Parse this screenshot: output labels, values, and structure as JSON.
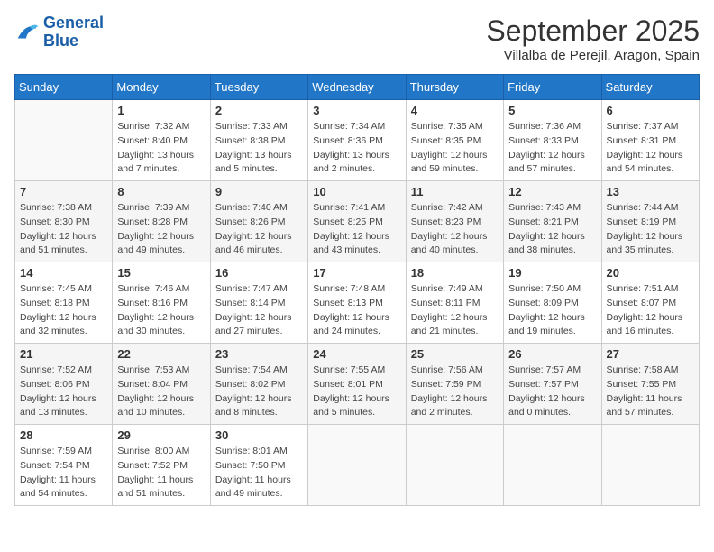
{
  "header": {
    "logo_line1": "General",
    "logo_line2": "Blue",
    "title": "September 2025",
    "subtitle": "Villalba de Perejil, Aragon, Spain"
  },
  "weekdays": [
    "Sunday",
    "Monday",
    "Tuesday",
    "Wednesday",
    "Thursday",
    "Friday",
    "Saturday"
  ],
  "weeks": [
    [
      {
        "day": "",
        "sunrise": "",
        "sunset": "",
        "daylight": ""
      },
      {
        "day": "1",
        "sunrise": "Sunrise: 7:32 AM",
        "sunset": "Sunset: 8:40 PM",
        "daylight": "Daylight: 13 hours and 7 minutes."
      },
      {
        "day": "2",
        "sunrise": "Sunrise: 7:33 AM",
        "sunset": "Sunset: 8:38 PM",
        "daylight": "Daylight: 13 hours and 5 minutes."
      },
      {
        "day": "3",
        "sunrise": "Sunrise: 7:34 AM",
        "sunset": "Sunset: 8:36 PM",
        "daylight": "Daylight: 13 hours and 2 minutes."
      },
      {
        "day": "4",
        "sunrise": "Sunrise: 7:35 AM",
        "sunset": "Sunset: 8:35 PM",
        "daylight": "Daylight: 12 hours and 59 minutes."
      },
      {
        "day": "5",
        "sunrise": "Sunrise: 7:36 AM",
        "sunset": "Sunset: 8:33 PM",
        "daylight": "Daylight: 12 hours and 57 minutes."
      },
      {
        "day": "6",
        "sunrise": "Sunrise: 7:37 AM",
        "sunset": "Sunset: 8:31 PM",
        "daylight": "Daylight: 12 hours and 54 minutes."
      }
    ],
    [
      {
        "day": "7",
        "sunrise": "Sunrise: 7:38 AM",
        "sunset": "Sunset: 8:30 PM",
        "daylight": "Daylight: 12 hours and 51 minutes."
      },
      {
        "day": "8",
        "sunrise": "Sunrise: 7:39 AM",
        "sunset": "Sunset: 8:28 PM",
        "daylight": "Daylight: 12 hours and 49 minutes."
      },
      {
        "day": "9",
        "sunrise": "Sunrise: 7:40 AM",
        "sunset": "Sunset: 8:26 PM",
        "daylight": "Daylight: 12 hours and 46 minutes."
      },
      {
        "day": "10",
        "sunrise": "Sunrise: 7:41 AM",
        "sunset": "Sunset: 8:25 PM",
        "daylight": "Daylight: 12 hours and 43 minutes."
      },
      {
        "day": "11",
        "sunrise": "Sunrise: 7:42 AM",
        "sunset": "Sunset: 8:23 PM",
        "daylight": "Daylight: 12 hours and 40 minutes."
      },
      {
        "day": "12",
        "sunrise": "Sunrise: 7:43 AM",
        "sunset": "Sunset: 8:21 PM",
        "daylight": "Daylight: 12 hours and 38 minutes."
      },
      {
        "day": "13",
        "sunrise": "Sunrise: 7:44 AM",
        "sunset": "Sunset: 8:19 PM",
        "daylight": "Daylight: 12 hours and 35 minutes."
      }
    ],
    [
      {
        "day": "14",
        "sunrise": "Sunrise: 7:45 AM",
        "sunset": "Sunset: 8:18 PM",
        "daylight": "Daylight: 12 hours and 32 minutes."
      },
      {
        "day": "15",
        "sunrise": "Sunrise: 7:46 AM",
        "sunset": "Sunset: 8:16 PM",
        "daylight": "Daylight: 12 hours and 30 minutes."
      },
      {
        "day": "16",
        "sunrise": "Sunrise: 7:47 AM",
        "sunset": "Sunset: 8:14 PM",
        "daylight": "Daylight: 12 hours and 27 minutes."
      },
      {
        "day": "17",
        "sunrise": "Sunrise: 7:48 AM",
        "sunset": "Sunset: 8:13 PM",
        "daylight": "Daylight: 12 hours and 24 minutes."
      },
      {
        "day": "18",
        "sunrise": "Sunrise: 7:49 AM",
        "sunset": "Sunset: 8:11 PM",
        "daylight": "Daylight: 12 hours and 21 minutes."
      },
      {
        "day": "19",
        "sunrise": "Sunrise: 7:50 AM",
        "sunset": "Sunset: 8:09 PM",
        "daylight": "Daylight: 12 hours and 19 minutes."
      },
      {
        "day": "20",
        "sunrise": "Sunrise: 7:51 AM",
        "sunset": "Sunset: 8:07 PM",
        "daylight": "Daylight: 12 hours and 16 minutes."
      }
    ],
    [
      {
        "day": "21",
        "sunrise": "Sunrise: 7:52 AM",
        "sunset": "Sunset: 8:06 PM",
        "daylight": "Daylight: 12 hours and 13 minutes."
      },
      {
        "day": "22",
        "sunrise": "Sunrise: 7:53 AM",
        "sunset": "Sunset: 8:04 PM",
        "daylight": "Daylight: 12 hours and 10 minutes."
      },
      {
        "day": "23",
        "sunrise": "Sunrise: 7:54 AM",
        "sunset": "Sunset: 8:02 PM",
        "daylight": "Daylight: 12 hours and 8 minutes."
      },
      {
        "day": "24",
        "sunrise": "Sunrise: 7:55 AM",
        "sunset": "Sunset: 8:01 PM",
        "daylight": "Daylight: 12 hours and 5 minutes."
      },
      {
        "day": "25",
        "sunrise": "Sunrise: 7:56 AM",
        "sunset": "Sunset: 7:59 PM",
        "daylight": "Daylight: 12 hours and 2 minutes."
      },
      {
        "day": "26",
        "sunrise": "Sunrise: 7:57 AM",
        "sunset": "Sunset: 7:57 PM",
        "daylight": "Daylight: 12 hours and 0 minutes."
      },
      {
        "day": "27",
        "sunrise": "Sunrise: 7:58 AM",
        "sunset": "Sunset: 7:55 PM",
        "daylight": "Daylight: 11 hours and 57 minutes."
      }
    ],
    [
      {
        "day": "28",
        "sunrise": "Sunrise: 7:59 AM",
        "sunset": "Sunset: 7:54 PM",
        "daylight": "Daylight: 11 hours and 54 minutes."
      },
      {
        "day": "29",
        "sunrise": "Sunrise: 8:00 AM",
        "sunset": "Sunset: 7:52 PM",
        "daylight": "Daylight: 11 hours and 51 minutes."
      },
      {
        "day": "30",
        "sunrise": "Sunrise: 8:01 AM",
        "sunset": "Sunset: 7:50 PM",
        "daylight": "Daylight: 11 hours and 49 minutes."
      },
      {
        "day": "",
        "sunrise": "",
        "sunset": "",
        "daylight": ""
      },
      {
        "day": "",
        "sunrise": "",
        "sunset": "",
        "daylight": ""
      },
      {
        "day": "",
        "sunrise": "",
        "sunset": "",
        "daylight": ""
      },
      {
        "day": "",
        "sunrise": "",
        "sunset": "",
        "daylight": ""
      }
    ]
  ]
}
